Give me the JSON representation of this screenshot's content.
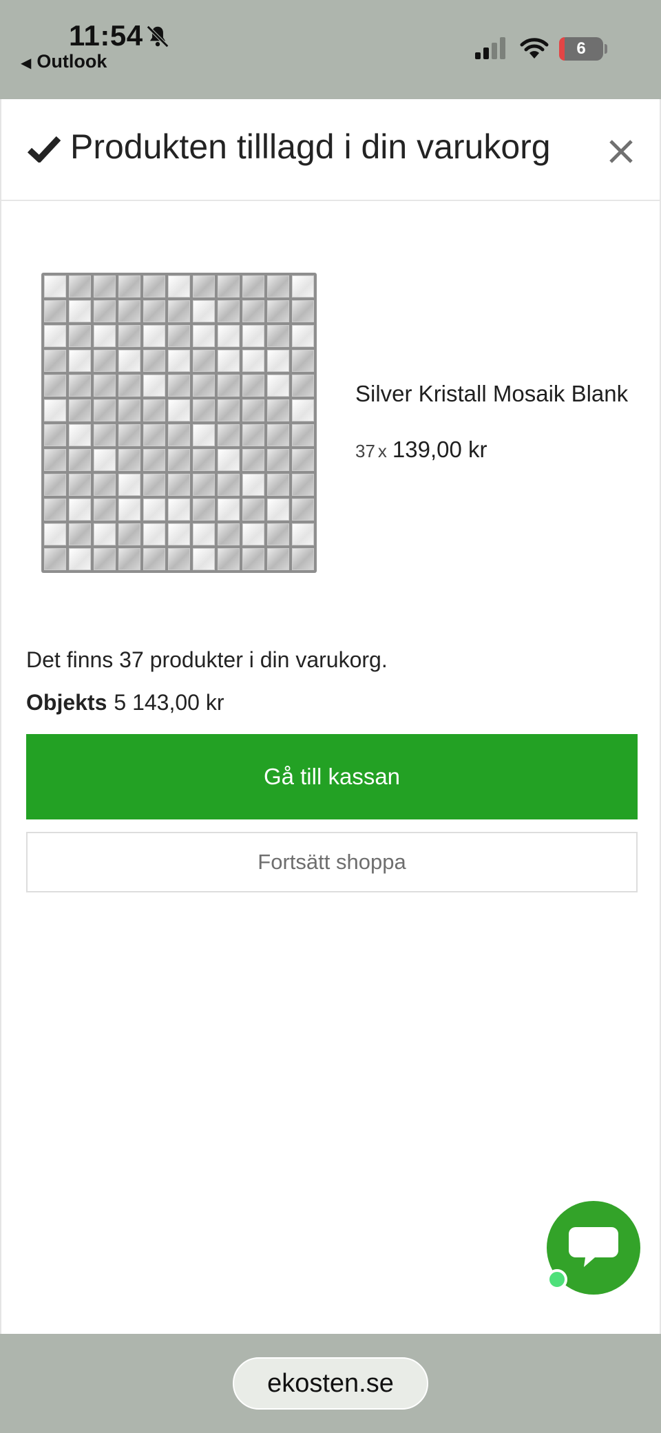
{
  "status_bar": {
    "time": "11:54",
    "back_app": "Outlook",
    "battery": "6"
  },
  "modal": {
    "title": "Produkten tilllagd i din varukorg"
  },
  "product": {
    "name": "Silver Kristall Mosaik Blank",
    "quantity": "37",
    "times": "x",
    "unit_price": "139,00 kr"
  },
  "cart": {
    "count_text": "Det finns 37 produkter i din varukorg.",
    "subtotal_label": "Objekts",
    "subtotal_value": "5 143,00 kr"
  },
  "buttons": {
    "checkout": "Gå till kassan",
    "continue": "Fortsätt shoppa"
  },
  "browser": {
    "url": "ekosten.se"
  },
  "colors": {
    "primary_green": "#23a124",
    "chat_green": "#33a329",
    "online_dot": "#4ee07a"
  },
  "icons": {
    "check": "check-icon",
    "close": "close-icon",
    "chat": "chat-bubble-icon",
    "bell": "bell-slash-icon"
  }
}
